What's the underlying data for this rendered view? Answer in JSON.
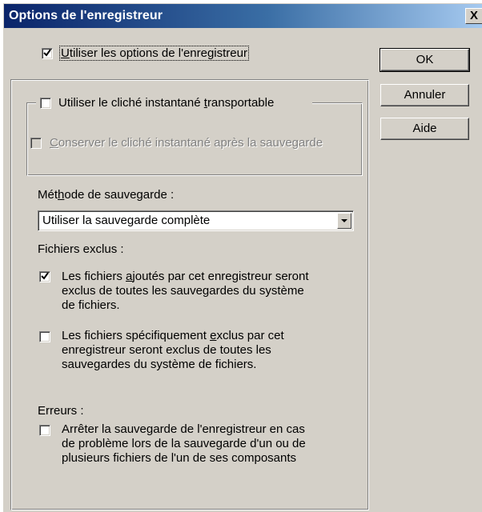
{
  "window": {
    "title": "Options de l'enregistreur",
    "close_glyph": "X"
  },
  "use_writer_options": {
    "checked": true,
    "pre": "",
    "key": "U",
    "post": "tiliser les options de l'enregistreur"
  },
  "transportable": {
    "checked": false,
    "pre": "Utiliser le cliché instantané ",
    "key": "t",
    "post": "ransportable"
  },
  "keep_snapshot": {
    "checked": false,
    "disabled": true,
    "pre": "",
    "key": "C",
    "post": "onserver le cliché instantané après la sauvegarde"
  },
  "method": {
    "pre": "Mét",
    "key": "h",
    "post": "ode de sauvegarde :",
    "selected": "Utiliser la sauvegarde complète"
  },
  "excluded": {
    "heading": "Fichiers exclus :",
    "added_files": {
      "checked": true,
      "pre": "Les fichiers ",
      "key": "a",
      "post": "joutés par cet enregistreur seront",
      "line2": "exclus de toutes les sauvegardes du système",
      "line3": "de fichiers."
    },
    "specific_files": {
      "checked": false,
      "pre": "Les fichiers spécifiquement ",
      "key": "e",
      "post": "xclus par cet",
      "line2": "enregistreur seront exclus de toutes les",
      "line3": "sauvegardes du système de fichiers."
    }
  },
  "errors": {
    "heading": "Erreurs :",
    "stop_backup": {
      "checked": false,
      "line1": "Arrêter la sauvegarde de l'enregistreur en cas",
      "line2": "de problème lors de la sauvegarde d'un ou de",
      "line3": "plusieurs fichiers de l'un de ses composants"
    }
  },
  "buttons": {
    "ok": "OK",
    "cancel": "Annuler",
    "help": "Aide"
  }
}
